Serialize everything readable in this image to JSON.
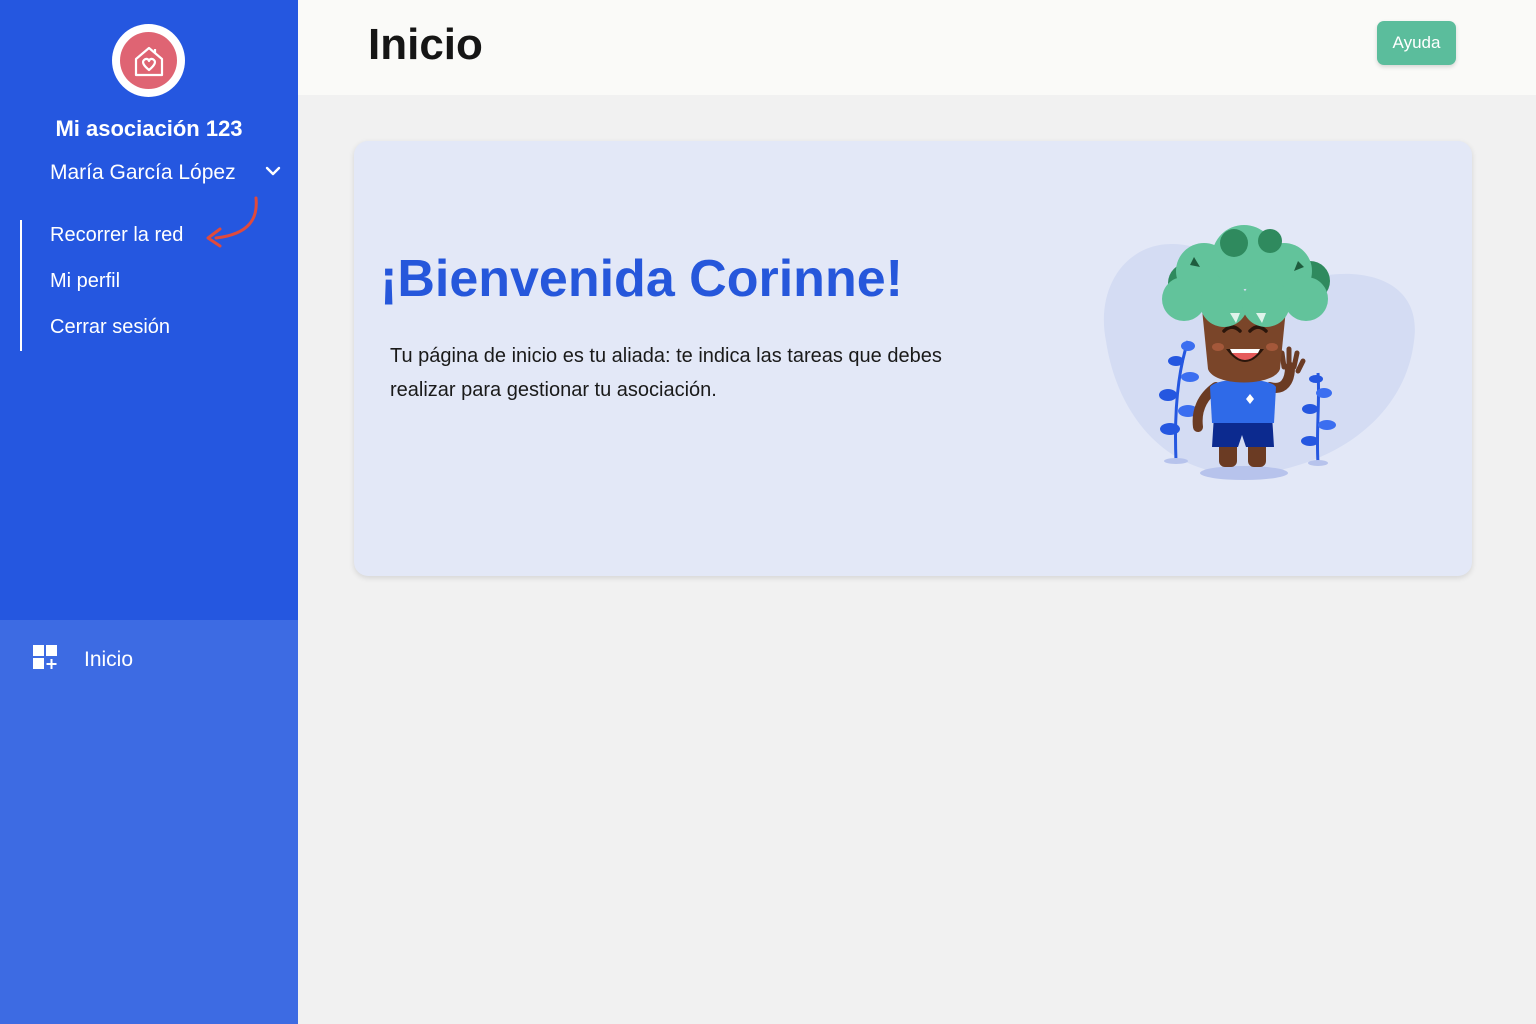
{
  "sidebar": {
    "org_name": "Mi asociación 123",
    "user_name": "María García López",
    "menu": [
      {
        "label": "Recorrer la red"
      },
      {
        "label": "Mi perfil"
      },
      {
        "label": "Cerrar sesión"
      }
    ],
    "nav": [
      {
        "label": "Inicio",
        "icon": "dashboard-icon"
      }
    ]
  },
  "header": {
    "title": "Inicio",
    "help_label": "Ayuda"
  },
  "welcome": {
    "title": "¡Bienvenida Corinne!",
    "text": "Tu página de inicio es tu aliada: te indica las tareas que debes realizar para gestionar tu asociación."
  },
  "colors": {
    "sidebar_top": "#2557e0",
    "sidebar_bottom": "#3d6be3",
    "accent_green": "#5bbd9c",
    "title_blue": "#2657db",
    "logo_red": "#df6473",
    "arrow_red": "#e04a3c"
  }
}
